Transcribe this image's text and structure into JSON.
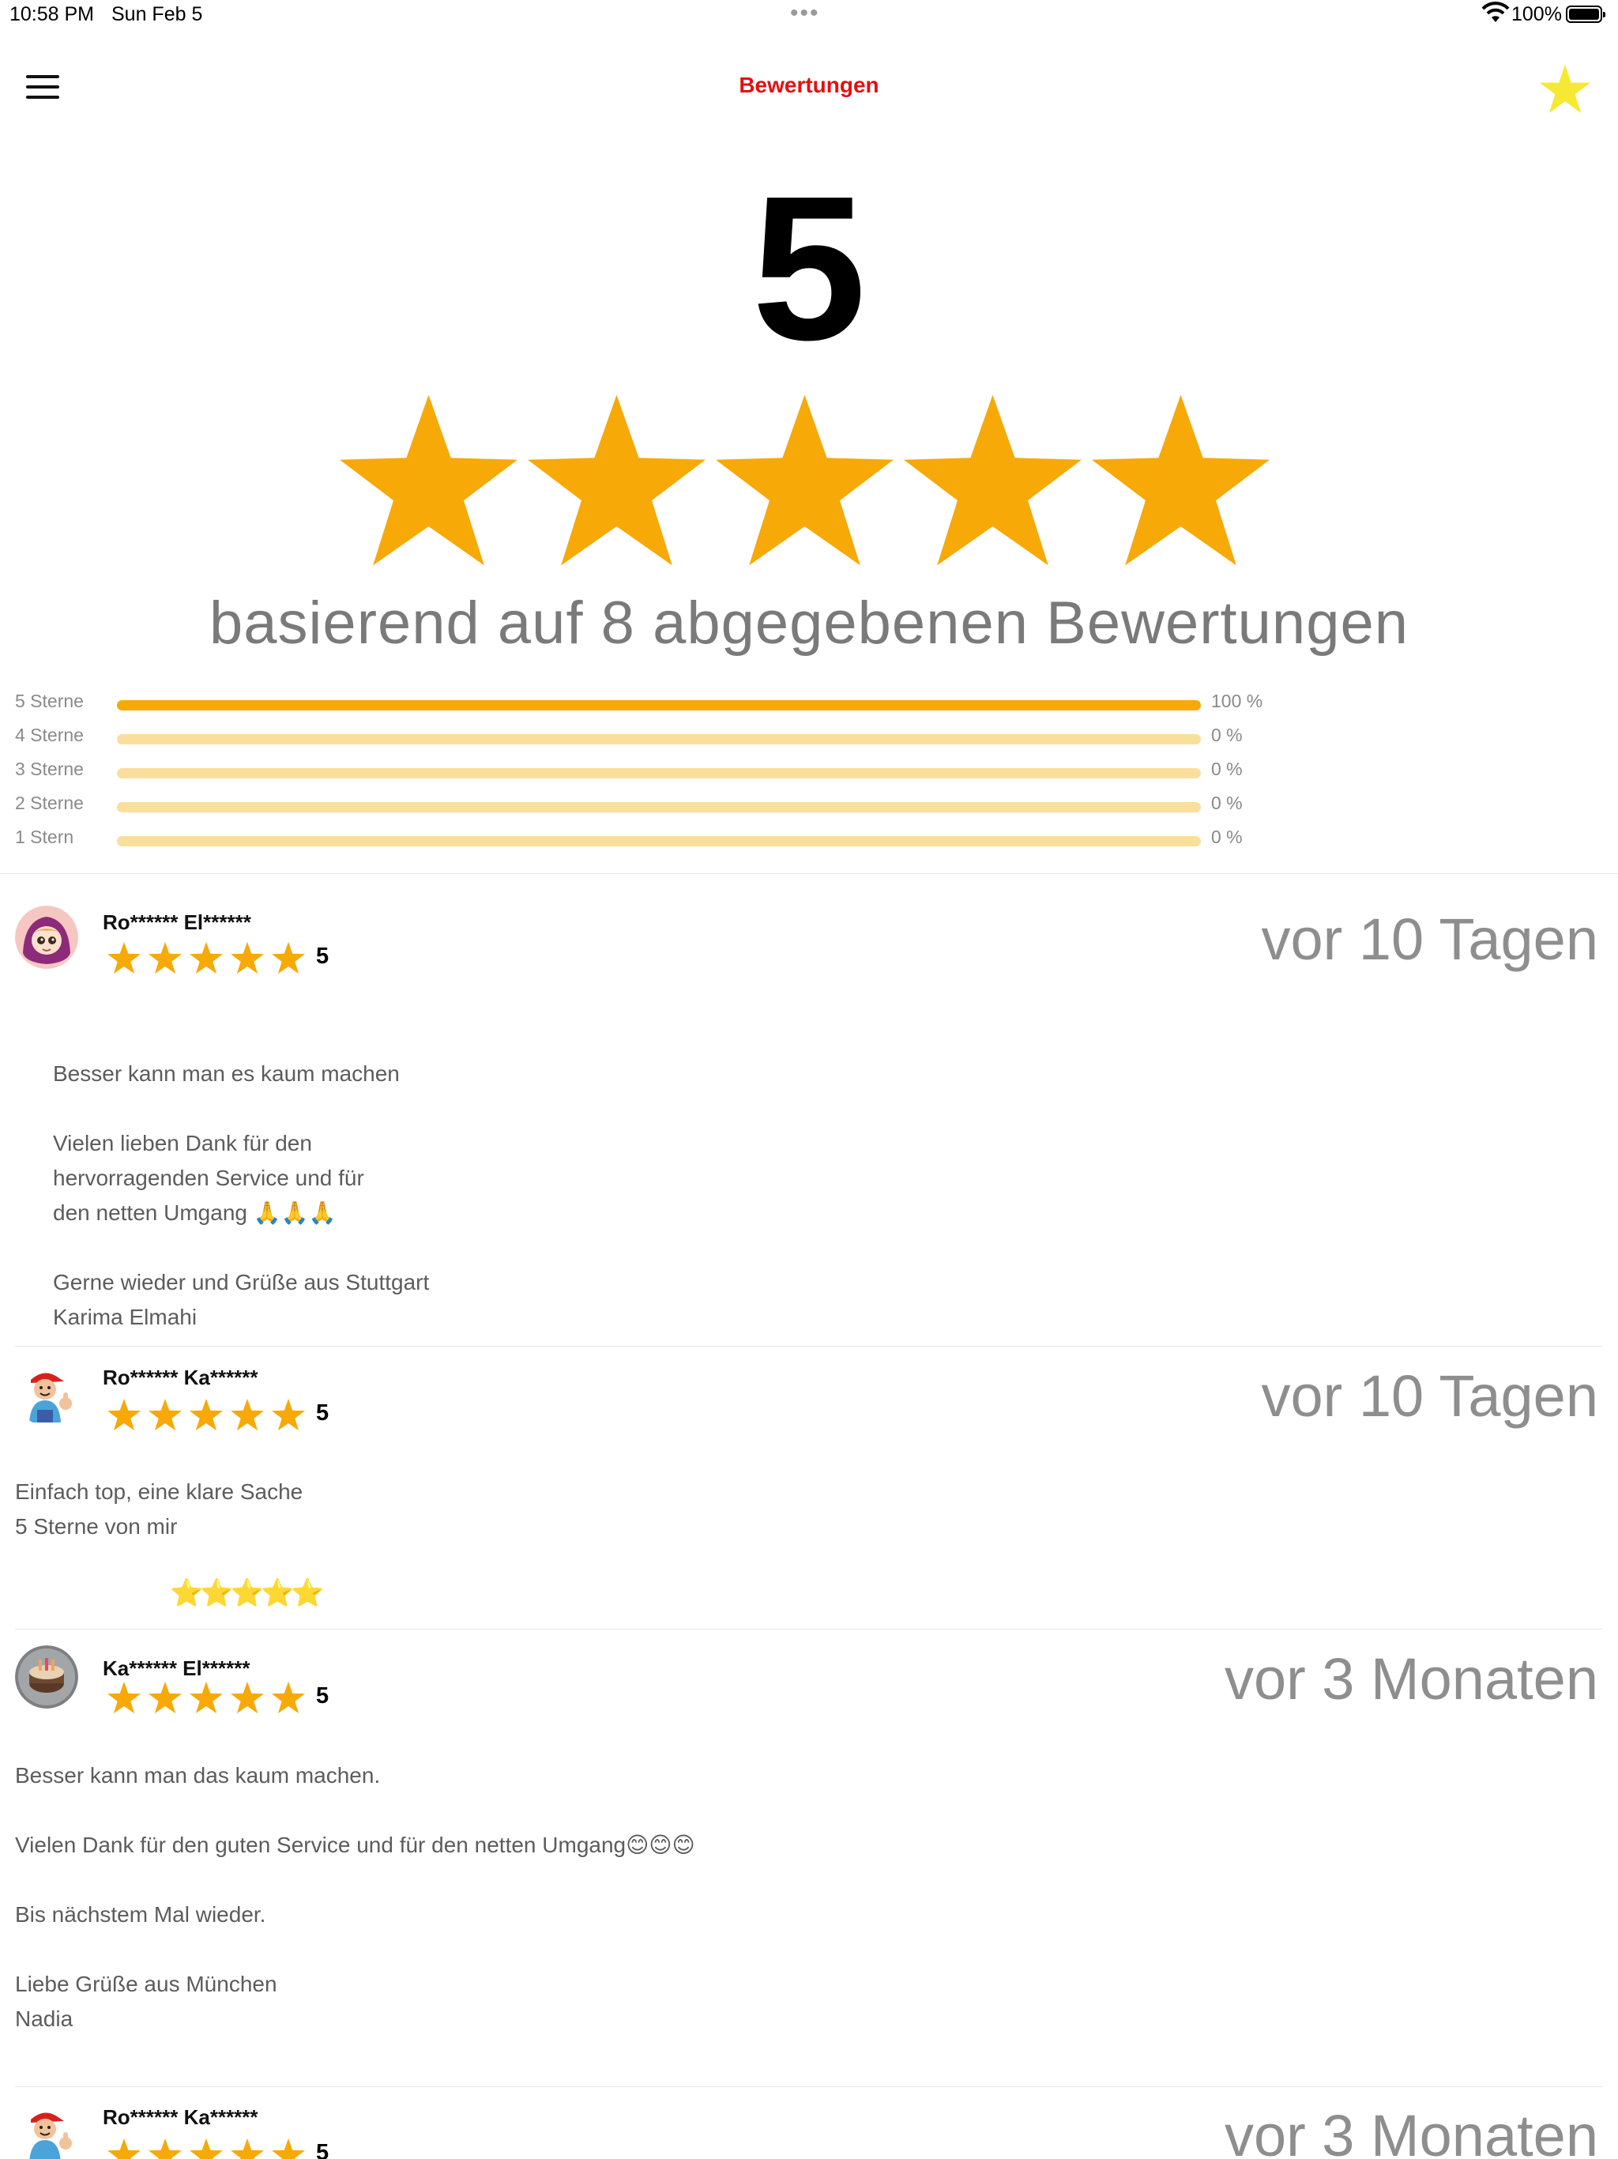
{
  "status_bar": {
    "time": "10:58 PM",
    "date": "Sun Feb 5",
    "dots": "•••",
    "battery": "100%"
  },
  "nav": {
    "title": "Bewertungen",
    "menu_icon": "hamburger-menu-icon",
    "right_icon": "star-icon",
    "title_color": "#e31010",
    "star_color": "#f5e933"
  },
  "summary": {
    "score": "5",
    "stars": 5,
    "based_on": "basierend auf 8 abgegebenen Bewertungen",
    "star_color": "#f7a907"
  },
  "distribution": [
    {
      "label": "5 Sterne",
      "percent": 100,
      "pct_text": "100 %"
    },
    {
      "label": "4 Sterne",
      "percent": 0,
      "pct_text": "0 %"
    },
    {
      "label": "3 Sterne",
      "percent": 0,
      "pct_text": "0 %"
    },
    {
      "label": "2 Sterne",
      "percent": 0,
      "pct_text": "0 %"
    },
    {
      "label": "1 Stern",
      "percent": 0,
      "pct_text": "0 %"
    }
  ],
  "reviews": [
    {
      "name": "Ro****** El******",
      "rating": "5",
      "time_ago": "vor 10 Tagen",
      "avatar": "girl-avatar-icon",
      "text_lines": [
        "Besser kann man es kaum machen",
        "",
        "Vielen lieben Dank für den",
        "hervorragenden Service und für",
        "den netten Umgang 🙏🙏🙏",
        "",
        "Gerne wieder und Grüße aus Stuttgart",
        "Karima Elmahi"
      ]
    },
    {
      "name": "Ro****** Ka******",
      "rating": "5",
      "time_ago": "vor 10 Tagen",
      "avatar": "thumbs-up-man-avatar-icon",
      "text_lines": [
        "Einfach top, eine klare Sache",
        "5 Sterne von mir"
      ],
      "emoji_stars": "⭐⭐⭐⭐⭐"
    },
    {
      "name": "Ka****** El******",
      "rating": "5",
      "time_ago": "vor 3 Monaten",
      "avatar": "cake-photo-avatar-icon",
      "text_lines": [
        "Besser kann man das kaum machen.",
        "",
        "Vielen Dank für den guten Service und für den netten Umgang😊😊😊",
        "",
        "Bis nächstem Mal wieder.",
        "",
        "Liebe Grüße aus München",
        "Nadia"
      ]
    },
    {
      "name": "Ro****** Ka******",
      "rating": "5",
      "time_ago": "vor 3 Monaten",
      "avatar": "thumbs-up-man-avatar-icon"
    }
  ]
}
